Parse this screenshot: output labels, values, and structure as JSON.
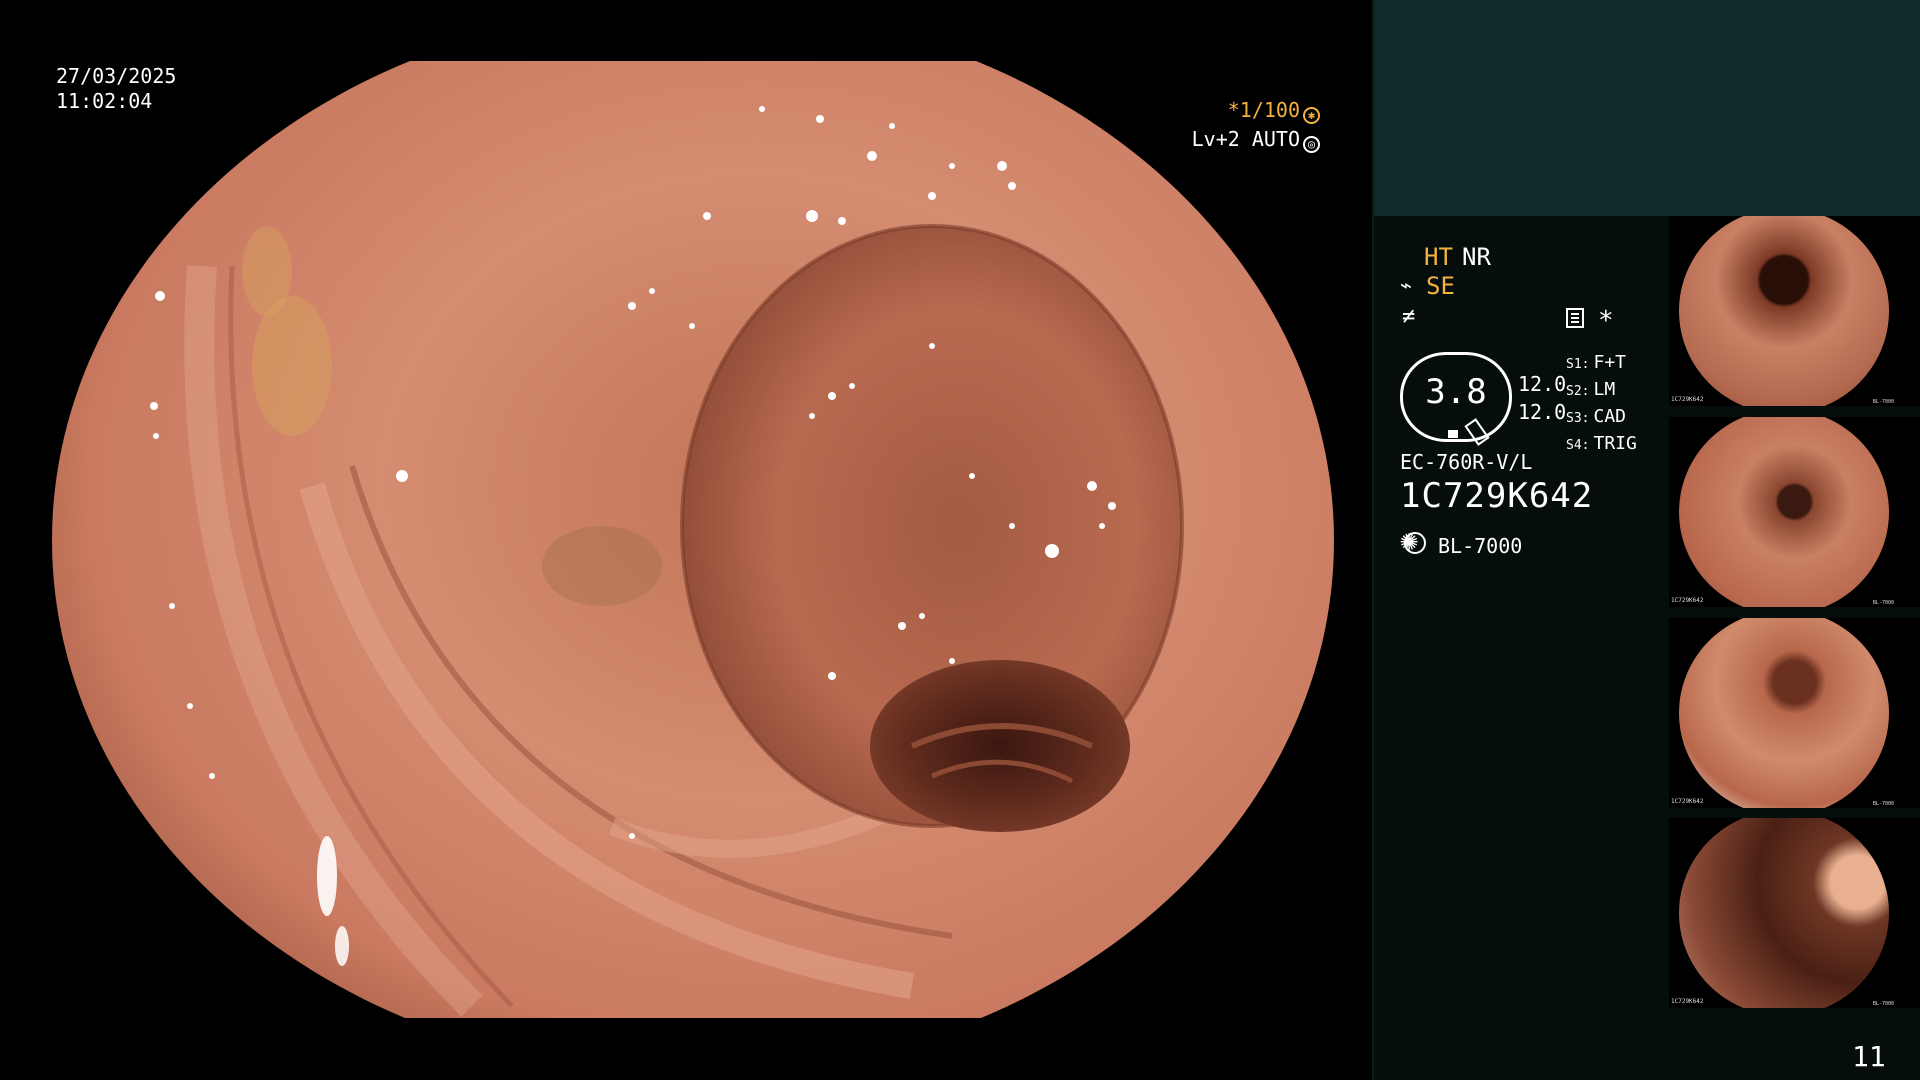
{
  "overlay": {
    "date": "27/03/2025",
    "time": "11:02:04",
    "exposure": "*1/100",
    "level": "Lv+2 AUTO"
  },
  "panel": {
    "ht": "HT",
    "nr": "NR",
    "se": "SE",
    "zoom": "3.8",
    "num1": "12.0",
    "num2": "12.0",
    "switches": [
      {
        "key": "S1:",
        "value": "F+T"
      },
      {
        "key": "S2:",
        "value": "LM"
      },
      {
        "key": "S3:",
        "value": "CAD"
      },
      {
        "key": "S4:",
        "value": "TRIG"
      }
    ],
    "model": "EC-760R-V/L",
    "serial": "1C729K642",
    "light_source": "BL-7000",
    "page": "11"
  },
  "thumbnails": [
    {
      "caption": "1C729K642",
      "light": "BL-7000"
    },
    {
      "caption": "1C729K642",
      "light": "BL-7000"
    },
    {
      "caption": "1C729K642",
      "light": "BL-7000"
    },
    {
      "caption": "1C729K642",
      "light": "BL-7000"
    }
  ],
  "colors": {
    "accent": "#f3b240",
    "panel_top": "#0f2a28",
    "panel": "#050e0d",
    "mucosa": "#c97a5f"
  },
  "icons": [
    "exposure-icon",
    "auto-icon",
    "se-icon",
    "freeze-icon",
    "menu-icon",
    "star-icon",
    "light-source-icon"
  ]
}
